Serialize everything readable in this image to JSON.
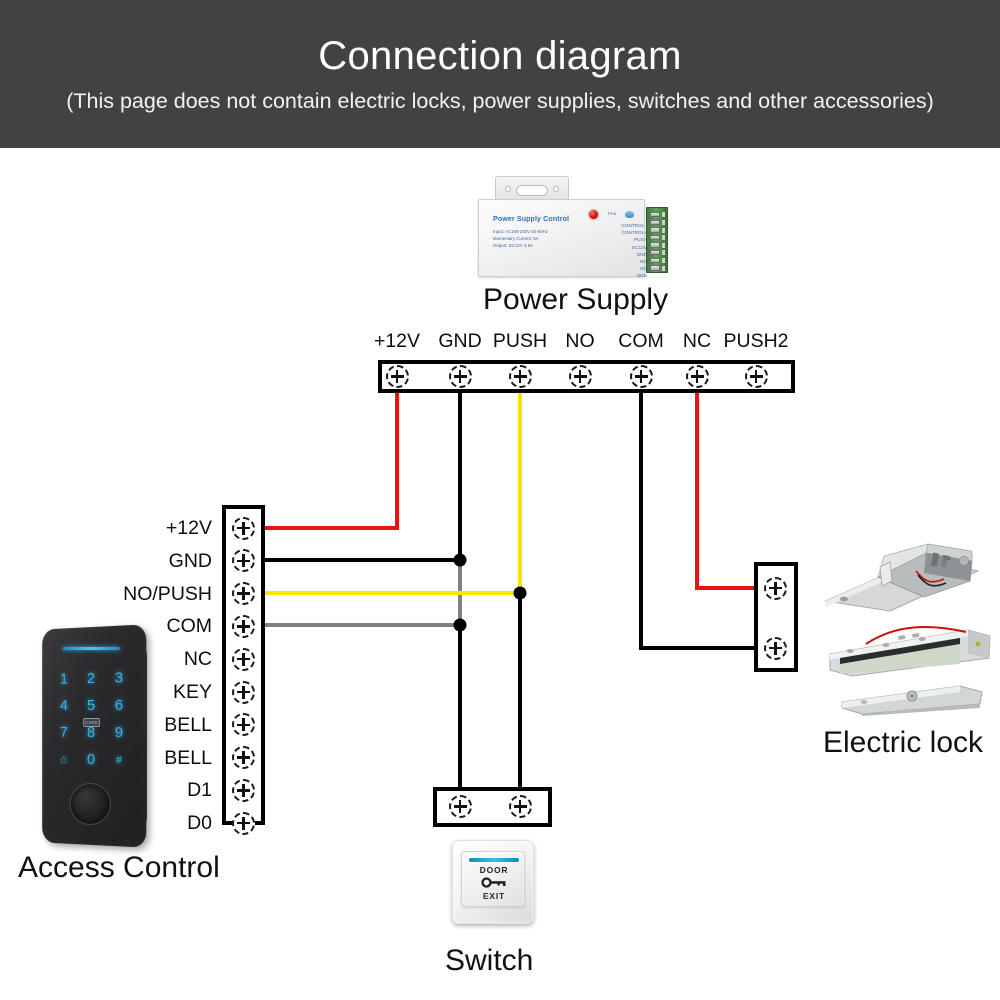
{
  "header": {
    "title": "Connection diagram",
    "subtitle": "(This page does not contain electric locks, power supplies, switches and other accessories)",
    "background_color": "#424242",
    "text_color": "#ffffff"
  },
  "power_supply": {
    "caption": "Power Supply",
    "label_title": "Power Supply Control",
    "spec_input": "Input: AC100-240V 50-60Hz",
    "spec_current": "Momentary Current: 5A",
    "spec_output": "Output: DC12V 3.5A",
    "brand": "Tma",
    "led_color": "#c20000",
    "terminal_labels": [
      "CONTROL -",
      "CONTROL+",
      "PUSH",
      "DC12V",
      "GND",
      "NO",
      "NC",
      "GND"
    ]
  },
  "main_terminal_strip": {
    "name": "power-supply-terminal-strip",
    "terminals": [
      "+12V",
      "GND",
      "PUSH",
      "NO",
      "COM",
      "NC",
      "PUSH2"
    ]
  },
  "access_control": {
    "caption": "Access Control",
    "terminals": [
      "+12V",
      "GND",
      "NO/PUSH",
      "COM",
      "NC",
      "KEY",
      "BELL",
      "BELL",
      "D1",
      "D0"
    ],
    "keypad_keys": [
      "1",
      "2",
      "3",
      "4",
      "5",
      "6",
      "7",
      "8",
      "9",
      "⌂",
      "0",
      "#"
    ],
    "card_label": "CARD",
    "accent_color": "#35b6ea"
  },
  "switch": {
    "caption": "Switch",
    "button_top_text": "DOOR",
    "button_bottom_text": "EXIT",
    "terminal_count": 2,
    "led_color": "#2fc4e8"
  },
  "electric_lock": {
    "caption": "Electric lock",
    "terminal_count": 2
  },
  "wiring": {
    "colors": {
      "red": "#ee1111",
      "black": "#000000",
      "yellow": "#ffe400",
      "gray": "#808080"
    },
    "connections": [
      {
        "from": "+12V (strip)",
        "to": "+12V (access control)",
        "color": "red"
      },
      {
        "from": "GND (strip)",
        "to": "GND (access control) / switch",
        "color": "black"
      },
      {
        "from": "PUSH (strip)",
        "to": "NO/PUSH (access control) / switch",
        "color": "yellow"
      },
      {
        "from": "COM (strip)",
        "to": "Electric lock terminal 2",
        "color": "black"
      },
      {
        "from": "NC (strip)",
        "to": "Electric lock terminal 1",
        "color": "red"
      },
      {
        "from": "COM (access control)",
        "to": "GND junction",
        "color": "gray"
      }
    ]
  }
}
